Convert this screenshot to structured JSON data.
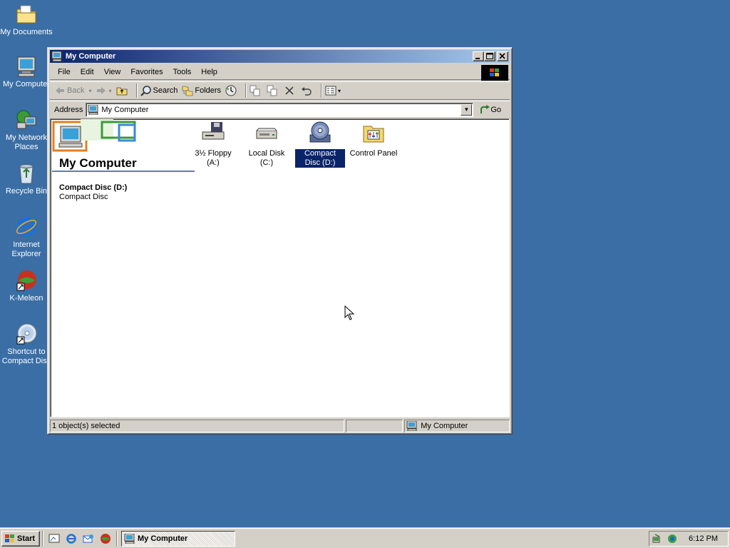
{
  "desktop": {
    "icons": [
      {
        "label": "My Documents",
        "icon": "folder-documents-icon"
      },
      {
        "label": "My Computer",
        "icon": "computer-icon"
      },
      {
        "label": "My Network Places",
        "icon": "network-places-icon"
      },
      {
        "label": "Recycle Bin",
        "icon": "recycle-bin-icon"
      },
      {
        "label": "Internet Explorer",
        "icon": "internet-explorer-icon"
      },
      {
        "label": "K-Meleon",
        "icon": "k-meleon-icon"
      },
      {
        "label": "Shortcut to Compact Disc",
        "icon": "cd-shortcut-icon"
      }
    ]
  },
  "window": {
    "title": "My Computer",
    "menu": [
      "File",
      "Edit",
      "View",
      "Favorites",
      "Tools",
      "Help"
    ],
    "toolbar": {
      "back": "Back",
      "search": "Search",
      "folders": "Folders"
    },
    "address": {
      "label": "Address",
      "value": "My Computer",
      "go": "Go"
    },
    "panel": {
      "title": "My Computer",
      "selected_name": "Compact Disc (D:)",
      "selected_type": "Compact Disc"
    },
    "items": [
      {
        "label": "3½ Floppy (A:)",
        "icon": "floppy-drive-icon",
        "selected": false
      },
      {
        "label": "Local Disk (C:)",
        "icon": "hard-disk-icon",
        "selected": false
      },
      {
        "label": "Compact Disc (D:)",
        "icon": "cd-drive-icon",
        "selected": true
      },
      {
        "label": "Control Panel",
        "icon": "control-panel-icon",
        "selected": false
      }
    ],
    "status": {
      "left": "1 object(s) selected",
      "zone": "My Computer"
    }
  },
  "taskbar": {
    "start": "Start",
    "task": "My Computer",
    "clock": "6:12 PM"
  },
  "colors": {
    "desktop": "#3a6ea5",
    "titlebar_start": "#0a246a",
    "titlebar_end": "#a6caf0",
    "selection": "#0a246a",
    "chrome": "#d4d0c8"
  }
}
